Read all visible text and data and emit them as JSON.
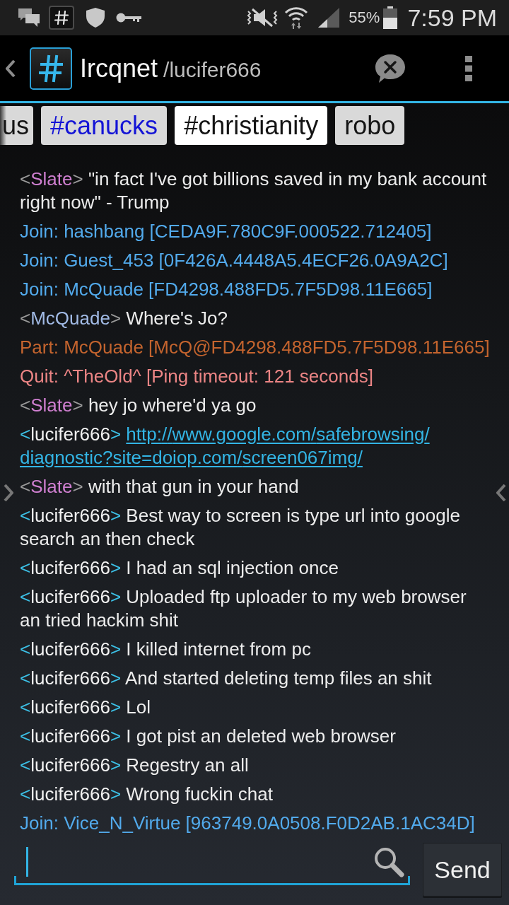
{
  "status_bar": {
    "battery": "55%",
    "time": "7:59 PM"
  },
  "action_bar": {
    "title": "Ircqnet",
    "subtitle": "/lucifer666"
  },
  "tabs": [
    {
      "label": "us",
      "selected": false,
      "unread": false,
      "clipped": true
    },
    {
      "label": "#canucks",
      "selected": false,
      "unread": true,
      "clipped": false
    },
    {
      "label": "#christianity",
      "selected": true,
      "unread": false,
      "clipped": false
    },
    {
      "label": "robo",
      "selected": false,
      "unread": false,
      "clipped": false
    }
  ],
  "messages": [
    {
      "kind": "message",
      "open": "<",
      "nick": "Slate",
      "close": ">",
      "color": "#cf7fd0",
      "text": "\"in fact I've got billions saved in my bank account right now\" - Trump"
    },
    {
      "kind": "join",
      "text": "Join: hashbang [CEDA9F.780C9F.000522.712405]"
    },
    {
      "kind": "join",
      "text": "Join: Guest_453 [0F426A.4448A5.4ECF26.0A9A2C]"
    },
    {
      "kind": "join",
      "text": "Join: McQuade [FD4298.488FD5.7F5D98.11E665]"
    },
    {
      "kind": "message",
      "open": "<",
      "nick": "McQuade",
      "close": ">",
      "color": "#a2bbe6",
      "text": "Where's Jo?"
    },
    {
      "kind": "part",
      "text": "Part: McQuade [McQ@FD4298.488FD5.7F5D98.11E665]"
    },
    {
      "kind": "quit",
      "text": "Quit: ^TheOld^ [Ping timeout: 121 seconds]"
    },
    {
      "kind": "message",
      "open": "<",
      "nick": "Slate",
      "close": ">",
      "color": "#cf7fd0",
      "text": "hey jo where'd ya go"
    },
    {
      "kind": "link",
      "open": "<",
      "nick": "lucifer666",
      "close": ">",
      "link": "http://www.google.com/safebrowsing/diagnostic?site=doiop.com/screen067img/"
    },
    {
      "kind": "message",
      "open": "<",
      "nick": "Slate",
      "close": ">",
      "color": "#cf7fd0",
      "text": "with that gun in your hand"
    },
    {
      "kind": "own",
      "open": "<",
      "nick": "lucifer666",
      "close": ">",
      "text": "Best way to screen is type url into google search an then check"
    },
    {
      "kind": "own",
      "open": "<",
      "nick": "lucifer666",
      "close": ">",
      "text": "I had an sql injection once"
    },
    {
      "kind": "own",
      "open": "<",
      "nick": "lucifer666",
      "close": ">",
      "text": "Uploaded ftp uploader to my web browser an tried hackim shit"
    },
    {
      "kind": "own",
      "open": "<",
      "nick": "lucifer666",
      "close": ">",
      "text": "I killed internet from pc"
    },
    {
      "kind": "own",
      "open": "<",
      "nick": "lucifer666",
      "close": ">",
      "text": "And started deleting temp files an shit"
    },
    {
      "kind": "own",
      "open": "<",
      "nick": "lucifer666",
      "close": ">",
      "text": "Lol"
    },
    {
      "kind": "own",
      "open": "<",
      "nick": "lucifer666",
      "close": ">",
      "text": "I got pist an deleted web browser"
    },
    {
      "kind": "own",
      "open": "<",
      "nick": "lucifer666",
      "close": ">",
      "text": "Regestry an all"
    },
    {
      "kind": "own",
      "open": "<",
      "nick": "lucifer666",
      "close": ">",
      "text": "Wrong fuckin chat"
    },
    {
      "kind": "join",
      "text": "Join: Vice_N_Virtue [963749.0A0508.F0D2AB.1AC34D]"
    }
  ],
  "composer": {
    "button": "Send"
  }
}
